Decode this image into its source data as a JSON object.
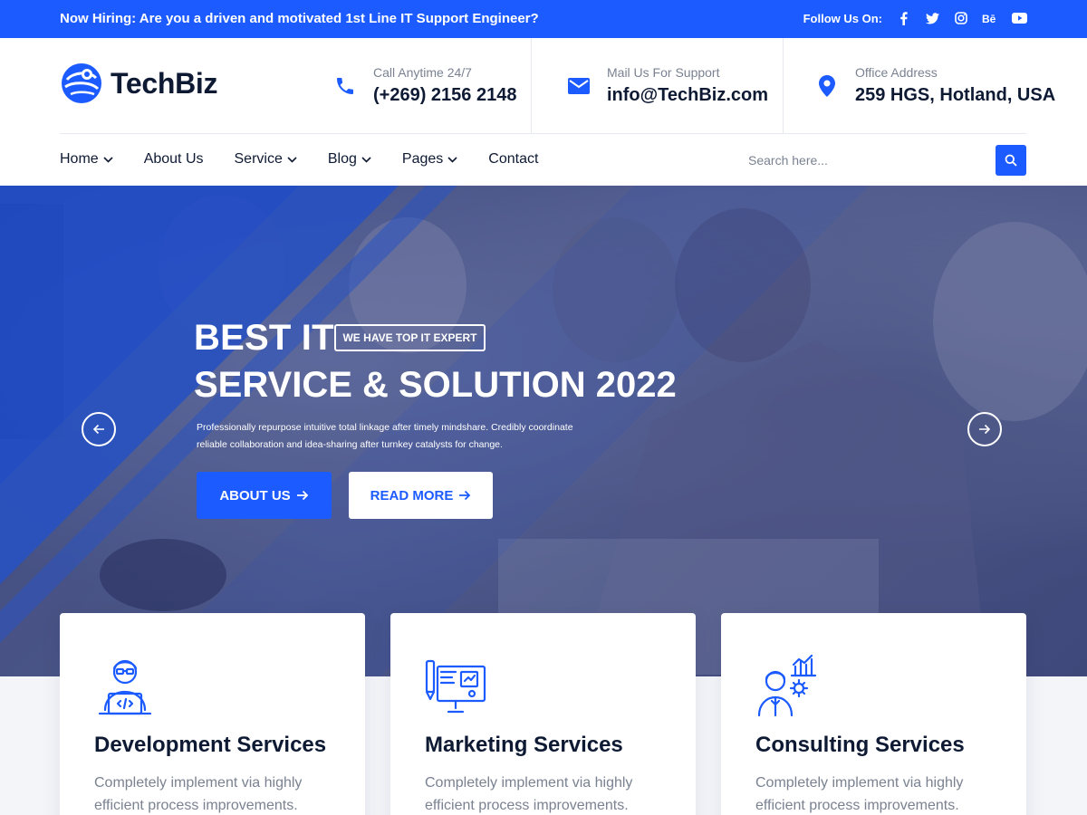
{
  "topbar": {
    "hiring_lead": "Now Hiring:",
    "hiring_text": "Are you a driven and motivated 1st Line IT Support Engineer?",
    "follow_label": "Follow Us On:",
    "social_icons": [
      "facebook-icon",
      "twitter-icon",
      "instagram-icon",
      "behance-icon",
      "youtube-icon"
    ]
  },
  "brand": {
    "name": "TechBiz",
    "accent_color": "#1c5bff"
  },
  "contacts": [
    {
      "icon": "phone-icon",
      "label": "Call Anytime 24/7",
      "value": "(+269) 2156 2148"
    },
    {
      "icon": "mail-icon",
      "label": "Mail Us For Support",
      "value": "info@TechBiz.com"
    },
    {
      "icon": "location-icon",
      "label": "Office Address",
      "value": "259 HGS, Hotland, USA"
    }
  ],
  "nav": {
    "items": [
      {
        "label": "Home",
        "dropdown": true
      },
      {
        "label": "About Us",
        "dropdown": false
      },
      {
        "label": "Service",
        "dropdown": true
      },
      {
        "label": "Blog",
        "dropdown": true
      },
      {
        "label": "Pages",
        "dropdown": true
      },
      {
        "label": "Contact",
        "dropdown": false
      }
    ],
    "search_placeholder": "Search here..."
  },
  "hero": {
    "title_line1": "BEST IT",
    "badge": "WE HAVE TOP IT EXPERT",
    "title_line2": "SERVICE & SOLUTION 2022",
    "description": "Professionally repurpose intuitive total linkage after timely mindshare. Credibly coordinate reliable collaboration and idea-sharing after turnkey catalysts for change.",
    "primary_button": "ABOUT US",
    "secondary_button": "READ MORE"
  },
  "services": [
    {
      "icon": "developer-icon",
      "title": "Development Services",
      "text": "Completely implement via highly efficient process improvements."
    },
    {
      "icon": "marketing-board-icon",
      "title": "Marketing Services",
      "text": "Completely implement via highly efficient process improvements."
    },
    {
      "icon": "consultant-icon",
      "title": "Consulting Services",
      "text": "Completely implement via highly efficient process improvements."
    }
  ]
}
